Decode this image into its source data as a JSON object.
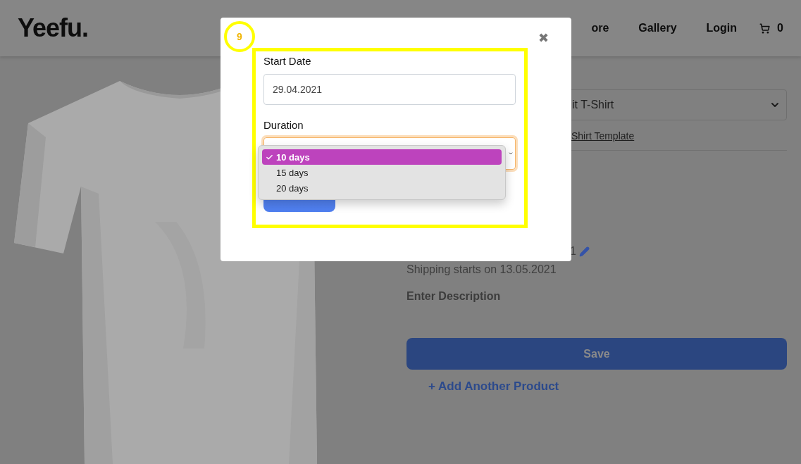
{
  "header": {
    "logo": "Yeefu.",
    "nav": [
      {
        "label": "ore"
      },
      {
        "label": "Gallery"
      },
      {
        "label": "Login"
      }
    ],
    "cart_count": "0"
  },
  "product": {
    "type_select": {
      "value": "it T-Shirt"
    },
    "template_link": "Shirt Template",
    "date_fragment": "1",
    "shipping": "Shipping starts on 13.05.2021",
    "description": {
      "placeholder": "Enter Description"
    },
    "save": "Save",
    "add_another": "+ Add Another Product"
  },
  "modal": {
    "annotation_number": "9",
    "close": "✖",
    "start_date": {
      "label": "Start Date",
      "value": "29.04.2021"
    },
    "duration": {
      "label": "Duration"
    },
    "duration_options": [
      {
        "label": "10 days",
        "selected": true
      },
      {
        "label": "15 days",
        "selected": false
      },
      {
        "label": "20 days",
        "selected": false
      }
    ]
  }
}
